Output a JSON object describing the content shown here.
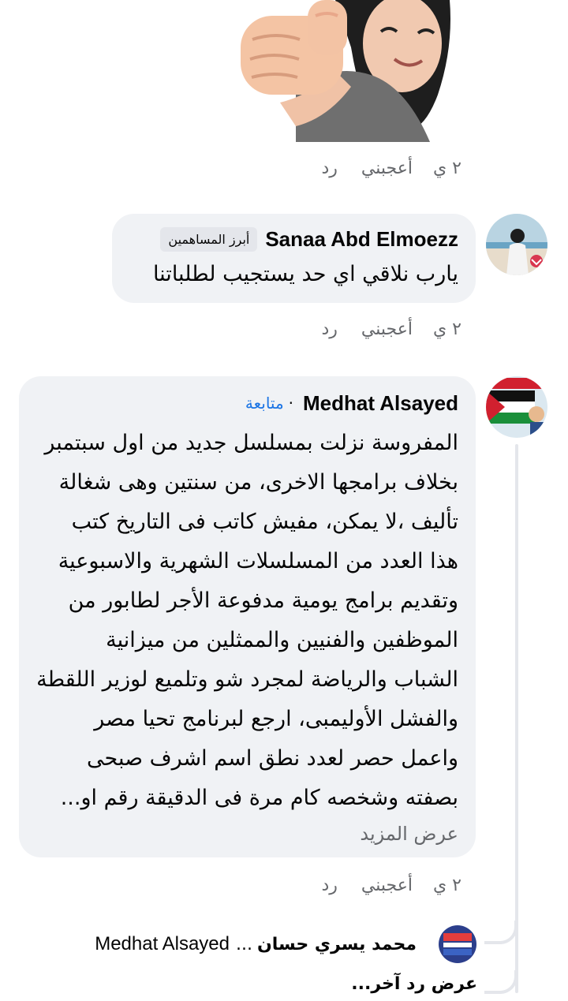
{
  "sticker": {
    "icon": "thumbs-up-sticker"
  },
  "comments": [
    {
      "actions": {
        "time": "٢ ي",
        "like": "أعجبني",
        "reply": "رد"
      }
    },
    {
      "author": "Sanaa Abd Elmoezz",
      "badge": "أبرز المساهمين",
      "text": "يارب نلاقي اي حد يستجيب لطلباتنا",
      "actions": {
        "time": "٢ ي",
        "like": "أعجبني",
        "reply": "رد"
      }
    },
    {
      "author": "Medhat Alsayed",
      "follow": "متابعة",
      "follow_dot": "·",
      "lines": [
        "المفروسة نزلت بمسلسل جديد من اول سبتمبر",
        "بخلاف برامجها الاخرى، من سنتين وهى شغالة",
        "تأليف ،لا يمكن، مفيش كاتب فى التاريخ كتب",
        "هذا العدد من المسلسلات الشهرية والاسبوعية",
        "وتقديم برامج يومية مدفوعة الأجر لطابور من",
        "الموظفين والفنيين والممثلين من ميزانية",
        "الشباب والرياضة لمجرد شو وتلميع لوزير اللقطة",
        "والفشل الأوليمبى، ارجع لبرنامج تحيا مصر",
        "واعمل حصر لعدد نطق اسم اشرف صبحى",
        "بصفته وشخصه كام مرة فى الدقيقة رقم او..."
      ],
      "see_more": "عرض المزيد",
      "actions": {
        "time": "٢ ي",
        "like": "أعجبني",
        "reply": "رد"
      }
    }
  ],
  "reply_preview": {
    "name": "محمد يسري حسان",
    "ellipsis": "...",
    "target": "Medhat Alsayed"
  },
  "more_replies": "عرض رد آخر..."
}
